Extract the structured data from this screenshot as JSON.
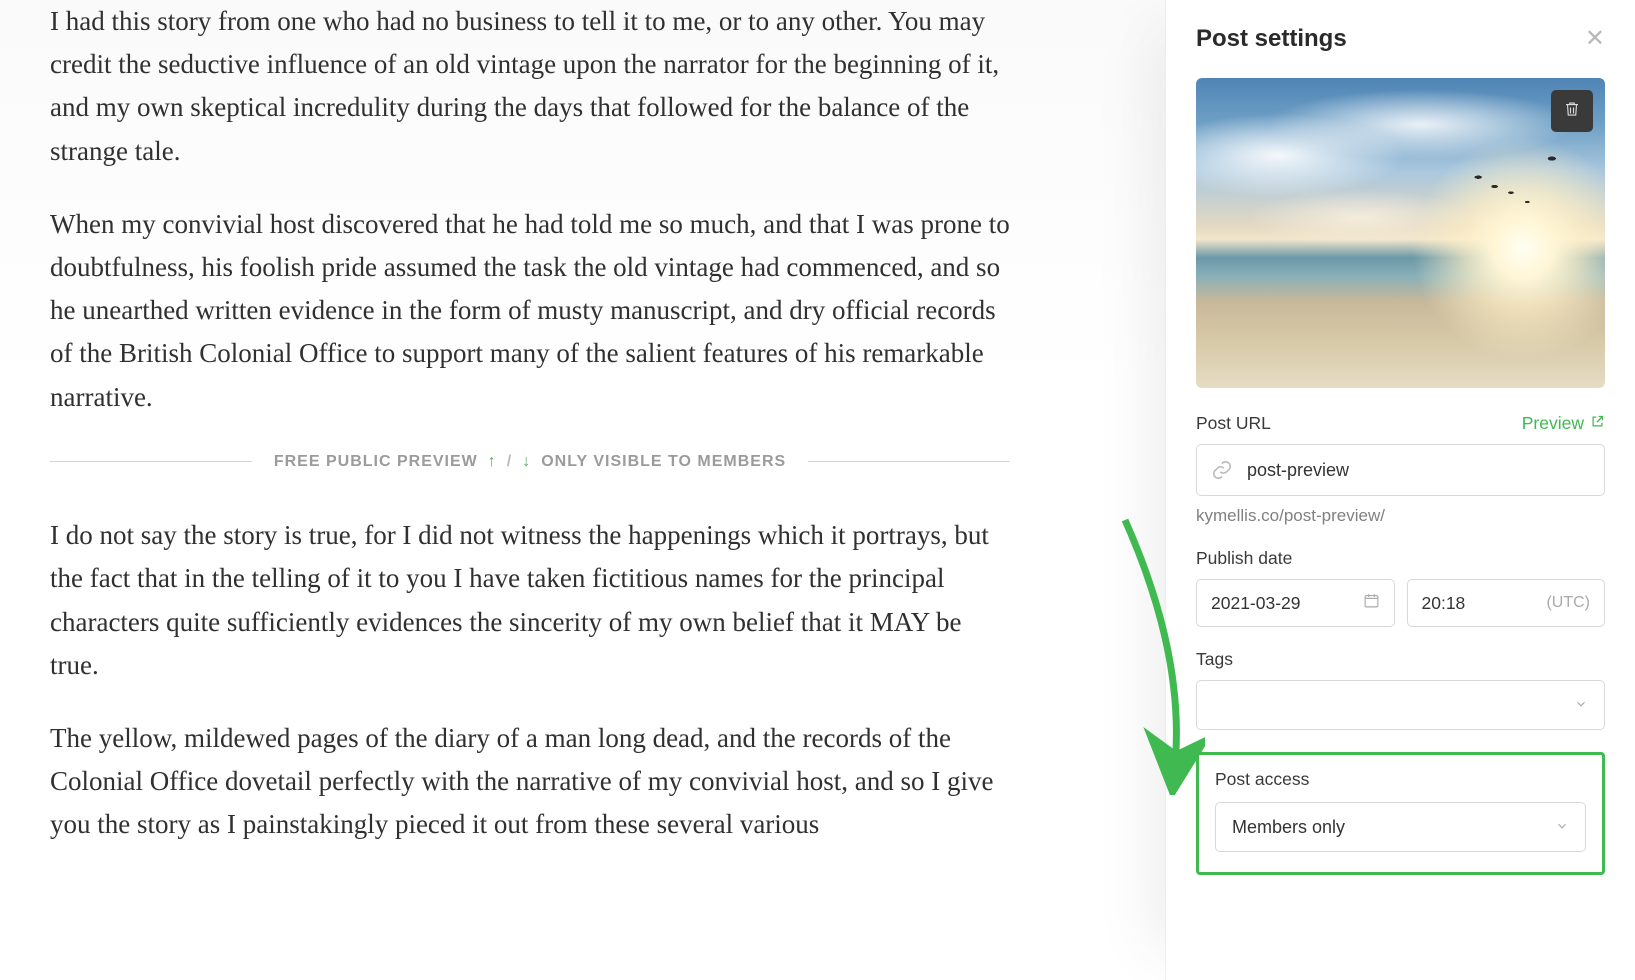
{
  "editor": {
    "p1": "I had this story from one who had no business to tell it to me, or to any other. You may credit the seductive influence of an old vintage upon the narrator for the beginning of it, and my own skeptical incredulity during the days that followed for the balance of the strange tale.",
    "p2": "When my convivial host discovered that he had told me so much, and that I was prone to doubtfulness, his foolish pride assumed the task the old vintage had commenced, and so he unearthed written evidence in the form of musty manuscript, and dry official records of the British Colonial Office to support many of the salient features of his remarkable narrative.",
    "divider_public": "FREE PUBLIC PREVIEW",
    "divider_members": "ONLY VISIBLE TO MEMBERS",
    "p3": "I do not say the story is true, for I did not witness the happenings which it portrays, but the fact that in the telling of it to you I have taken fictitious names for the principal characters quite sufficiently evidences the sincerity of my own belief that it MAY be true.",
    "p4": "The yellow, mildewed pages of the diary of a man long dead, and the records of the Colonial Office dovetail perfectly with the narrative of my convivial host, and so I give you the story as I painstakingly pieced it out from these several various"
  },
  "settings": {
    "title": "Post settings",
    "post_url_label": "Post URL",
    "preview_label": "Preview",
    "post_url_value": "post-preview",
    "full_url": "kymellis.co/post-preview/",
    "publish_date_label": "Publish date",
    "publish_date": "2021-03-29",
    "publish_time": "20:18",
    "utc_label": "(UTC)",
    "tags_label": "Tags",
    "tags_value": "",
    "post_access_label": "Post access",
    "post_access_value": "Members only"
  },
  "colors": {
    "accent": "#3fb950"
  }
}
